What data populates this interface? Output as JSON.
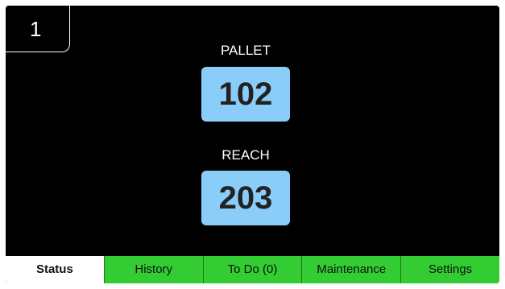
{
  "unit": {
    "number": "1"
  },
  "metrics": [
    {
      "label": "PALLET",
      "value": "102"
    },
    {
      "label": "REACH",
      "value": "203"
    }
  ],
  "tabs": [
    {
      "label": "Status",
      "active": true
    },
    {
      "label": "History"
    },
    {
      "label": "To Do (0)"
    },
    {
      "label": "Maintenance"
    },
    {
      "label": "Settings"
    }
  ],
  "colors": {
    "screen_background": "#000000",
    "value_box": "#89cdf8",
    "tab_background": "#33cc33",
    "active_tab_background": "#ffffff"
  }
}
